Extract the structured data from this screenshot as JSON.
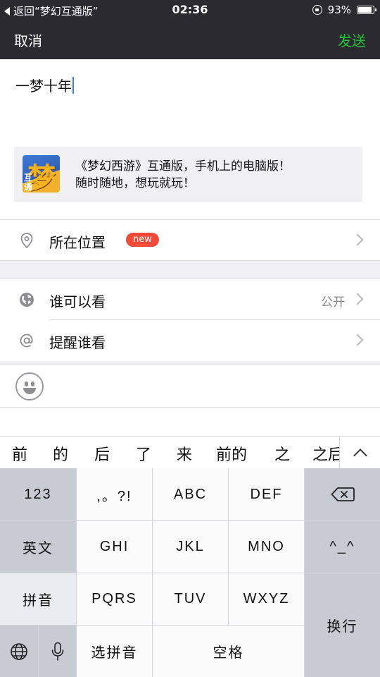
{
  "status_bar": {
    "back_label": "返回“梦幻互通版”",
    "time": "02:36",
    "battery_percent": "93%",
    "battery_level": 0.93,
    "icons": [
      "back-triangle-icon",
      "rotation-lock-icon",
      "battery-icon"
    ]
  },
  "nav": {
    "cancel_label": "取消",
    "send_label": "发送",
    "send_color": "#25c23a"
  },
  "composer": {
    "text": "一梦十年"
  },
  "share_card": {
    "thumb_big_char": "梦",
    "thumb_small_text": "互通",
    "line1": "《梦幻西游》互通版，手机上的电脑版！",
    "line2": "随时随地，想玩就玩！"
  },
  "rows": {
    "location": {
      "label": "所在位置",
      "badge": "new",
      "icon": "location-pin-icon"
    },
    "visibility": {
      "label": "谁可以看",
      "value": "公开",
      "icon": "globe-icon"
    },
    "mention": {
      "label": "提醒谁看",
      "icon": "at-icon"
    }
  },
  "candidates": [
    "前",
    "的",
    "后",
    "了",
    "来",
    "前的",
    "之",
    "之后"
  ],
  "keyboard": {
    "k_123": "123",
    "k_punct": ",。?!",
    "k_abc": "ABC",
    "k_def": "DEF",
    "k_en": "英文",
    "k_ghi": "GHI",
    "k_jkl": "JKL",
    "k_mno": "MNO",
    "k_emoticon": "^_^",
    "k_pinyin": "拼音",
    "k_pqrs": "PQRS",
    "k_tuv": "TUV",
    "k_wxyz": "WXYZ",
    "k_return": "换行",
    "k_select_pinyin": "选拼音",
    "k_space": "空格"
  }
}
